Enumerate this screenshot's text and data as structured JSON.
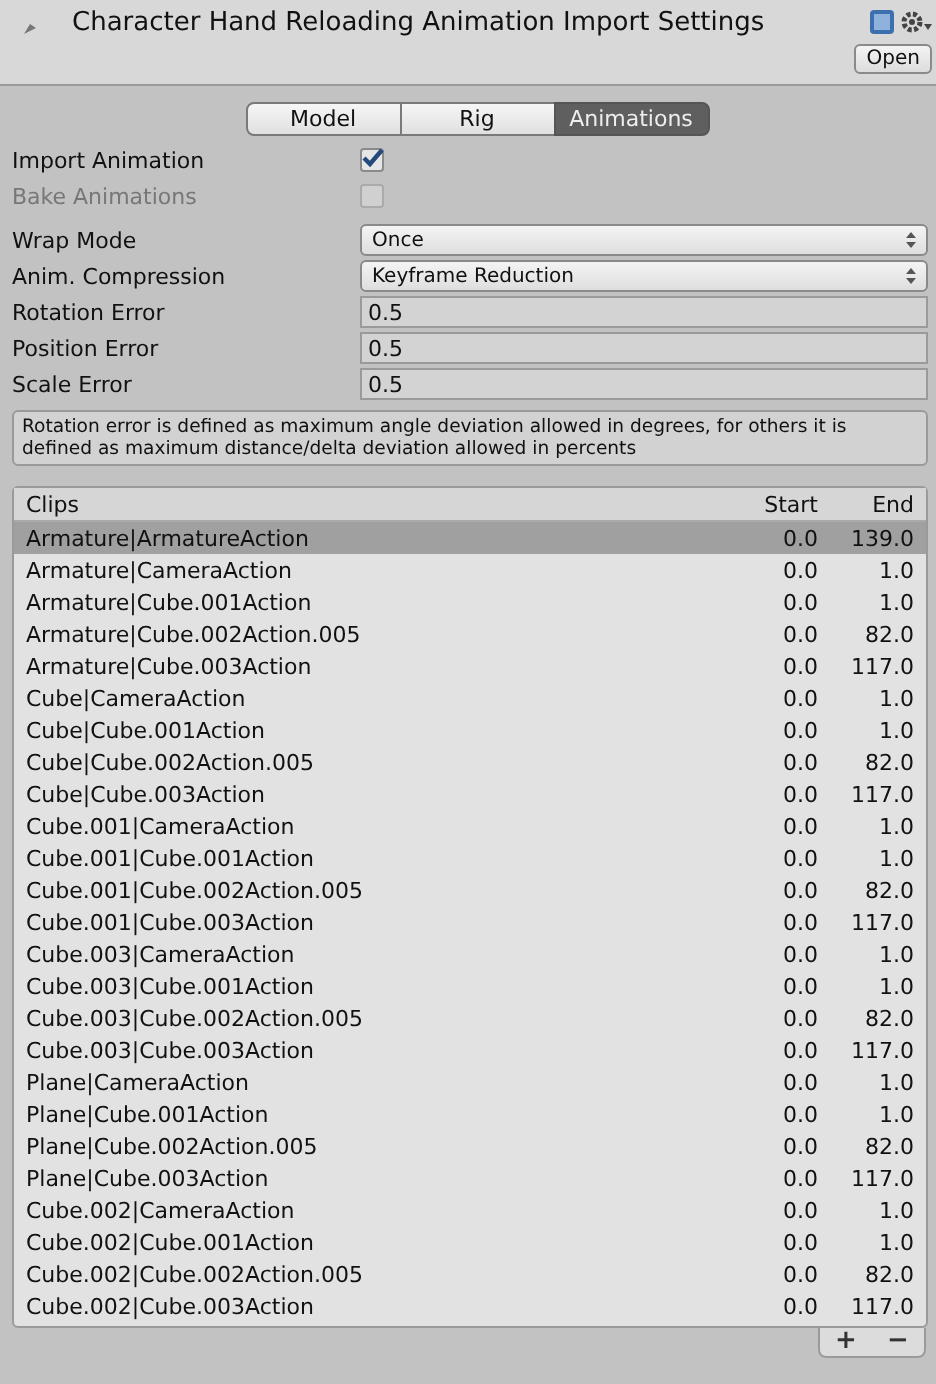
{
  "header": {
    "title": "Character Hand Reloading Animation Import Settings",
    "open_button": "Open"
  },
  "tabs": [
    {
      "label": "Model",
      "selected": false
    },
    {
      "label": "Rig",
      "selected": false
    },
    {
      "label": "Animations",
      "selected": true
    }
  ],
  "settings": [
    {
      "kind": "checkbox",
      "label": "Import Animation",
      "checked": true,
      "disabled": false
    },
    {
      "kind": "checkbox",
      "label": "Bake Animations",
      "checked": false,
      "disabled": true
    },
    {
      "kind": "dropdown",
      "label": "Wrap Mode",
      "value": "Once"
    },
    {
      "kind": "dropdown",
      "label": "Anim. Compression",
      "value": "Keyframe Reduction"
    },
    {
      "kind": "text",
      "label": "Rotation Error",
      "value": "0.5"
    },
    {
      "kind": "text",
      "label": "Position Error",
      "value": "0.5"
    },
    {
      "kind": "text",
      "label": "Scale Error",
      "value": "0.5"
    }
  ],
  "help_box": "Rotation error is defined as maximum angle deviation allowed in degrees, for others it is defined as maximum distance/delta deviation allowed in percents",
  "clips": {
    "columns": [
      "Clips",
      "Start",
      "End"
    ],
    "rows": [
      {
        "name": "Armature|ArmatureAction",
        "start": "0.0",
        "end": "139.0",
        "selected": true
      },
      {
        "name": "Armature|CameraAction",
        "start": "0.0",
        "end": "1.0",
        "selected": false
      },
      {
        "name": "Armature|Cube.001Action",
        "start": "0.0",
        "end": "1.0",
        "selected": false
      },
      {
        "name": "Armature|Cube.002Action.005",
        "start": "0.0",
        "end": "82.0",
        "selected": false
      },
      {
        "name": "Armature|Cube.003Action",
        "start": "0.0",
        "end": "117.0",
        "selected": false
      },
      {
        "name": "Cube|CameraAction",
        "start": "0.0",
        "end": "1.0",
        "selected": false
      },
      {
        "name": "Cube|Cube.001Action",
        "start": "0.0",
        "end": "1.0",
        "selected": false
      },
      {
        "name": "Cube|Cube.002Action.005",
        "start": "0.0",
        "end": "82.0",
        "selected": false
      },
      {
        "name": "Cube|Cube.003Action",
        "start": "0.0",
        "end": "117.0",
        "selected": false
      },
      {
        "name": "Cube.001|CameraAction",
        "start": "0.0",
        "end": "1.0",
        "selected": false
      },
      {
        "name": "Cube.001|Cube.001Action",
        "start": "0.0",
        "end": "1.0",
        "selected": false
      },
      {
        "name": "Cube.001|Cube.002Action.005",
        "start": "0.0",
        "end": "82.0",
        "selected": false
      },
      {
        "name": "Cube.001|Cube.003Action",
        "start": "0.0",
        "end": "117.0",
        "selected": false
      },
      {
        "name": "Cube.003|CameraAction",
        "start": "0.0",
        "end": "1.0",
        "selected": false
      },
      {
        "name": "Cube.003|Cube.001Action",
        "start": "0.0",
        "end": "1.0",
        "selected": false
      },
      {
        "name": "Cube.003|Cube.002Action.005",
        "start": "0.0",
        "end": "82.0",
        "selected": false
      },
      {
        "name": "Cube.003|Cube.003Action",
        "start": "0.0",
        "end": "117.0",
        "selected": false
      },
      {
        "name": "Plane|CameraAction",
        "start": "0.0",
        "end": "1.0",
        "selected": false
      },
      {
        "name": "Plane|Cube.001Action",
        "start": "0.0",
        "end": "1.0",
        "selected": false
      },
      {
        "name": "Plane|Cube.002Action.005",
        "start": "0.0",
        "end": "82.0",
        "selected": false
      },
      {
        "name": "Plane|Cube.003Action",
        "start": "0.0",
        "end": "117.0",
        "selected": false
      },
      {
        "name": "Cube.002|CameraAction",
        "start": "0.0",
        "end": "1.0",
        "selected": false
      },
      {
        "name": "Cube.002|Cube.001Action",
        "start": "0.0",
        "end": "1.0",
        "selected": false
      },
      {
        "name": "Cube.002|Cube.002Action.005",
        "start": "0.0",
        "end": "82.0",
        "selected": false
      },
      {
        "name": "Cube.002|Cube.003Action",
        "start": "0.0",
        "end": "117.0",
        "selected": false
      }
    ],
    "add_button": "+",
    "remove_button": "−"
  }
}
